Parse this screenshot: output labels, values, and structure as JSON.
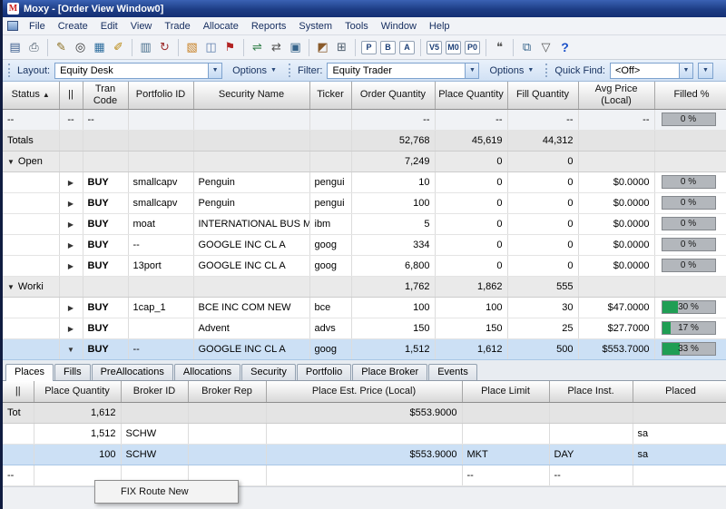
{
  "window": {
    "title": "Moxy - [Order View Window0]",
    "icon_letter": "M"
  },
  "icons": {
    "chevron_down": "▼",
    "sort_asc": "▲",
    "expand_right": "▶",
    "expand_down": "▼"
  },
  "menu": {
    "items": [
      "File",
      "Create",
      "Edit",
      "View",
      "Trade",
      "Allocate",
      "Reports",
      "System",
      "Tools",
      "Window",
      "Help"
    ]
  },
  "toolbar": {
    "icons": [
      {
        "name": "save-icon",
        "glyph": "▤",
        "color": "#3d5f8f"
      },
      {
        "name": "print-icon",
        "glyph": "⎙",
        "color": "#4a5a6a"
      },
      {
        "sep": true
      },
      {
        "name": "edit-icon",
        "glyph": "✎",
        "color": "#8a6d1d"
      },
      {
        "name": "find-icon",
        "glyph": "◎",
        "color": "#333333"
      },
      {
        "name": "worksheet-icon",
        "glyph": "▦",
        "color": "#2e6e9e"
      },
      {
        "name": "design-icon",
        "glyph": "✐",
        "color": "#b8860b"
      },
      {
        "sep": true
      },
      {
        "name": "blotter-icon",
        "glyph": "▥",
        "color": "#4a708e"
      },
      {
        "name": "refresh-icon",
        "glyph": "↻",
        "color": "#9e2f2f"
      },
      {
        "sep": true
      },
      {
        "name": "document-icon",
        "glyph": "▧",
        "color": "#c77e1e"
      },
      {
        "name": "notebook-icon",
        "glyph": "◫",
        "color": "#5f7fae"
      },
      {
        "name": "flag-icon",
        "glyph": "⚑",
        "color": "#b22222"
      },
      {
        "sep": true
      },
      {
        "name": "allocate-icon",
        "glyph": "⇌",
        "color": "#2e7d46"
      },
      {
        "name": "transfer-icon",
        "glyph": "⇄",
        "color": "#555555"
      },
      {
        "name": "monitor-icon",
        "glyph": "▣",
        "color": "#36648b"
      },
      {
        "sep": true
      },
      {
        "name": "chart-icon",
        "glyph": "◩",
        "color": "#8a5a2a"
      },
      {
        "name": "calculator-icon",
        "glyph": "⊞",
        "color": "#4f5f6f"
      },
      {
        "sep": true
      },
      {
        "name": "p-letter-icon",
        "glyph": "P",
        "boxed": true
      },
      {
        "name": "b-letter-icon",
        "glyph": "B",
        "boxed": true
      },
      {
        "name": "a-letter-icon",
        "glyph": "A",
        "boxed": true
      },
      {
        "sep": true
      },
      {
        "name": "v5-icon",
        "glyph": "V5",
        "boxed": true
      },
      {
        "name": "m0-icon",
        "glyph": "M0",
        "boxed": true
      },
      {
        "name": "p0-icon",
        "glyph": "P0",
        "boxed": true
      },
      {
        "sep": true
      },
      {
        "name": "comment-icon",
        "glyph": "❝",
        "color": "#555555"
      },
      {
        "sep": true
      },
      {
        "name": "report-window-icon",
        "glyph": "⧉",
        "color": "#36648b"
      },
      {
        "name": "filter-icon",
        "glyph": "▽",
        "color": "#555555"
      },
      {
        "name": "help-icon",
        "glyph": "?",
        "color": "#1a50c8",
        "bold": true
      }
    ]
  },
  "layout_bar": {
    "layout_label": "Layout:",
    "layout_value": "Equity Desk",
    "layout_options_label": "Options",
    "filter_label": "Filter:",
    "filter_value": "Equity Trader",
    "filter_options_label": "Options",
    "quick_find_label": "Quick Find:",
    "quick_find_value": "<Off>"
  },
  "orders_table": {
    "columns": [
      "Status",
      "||",
      "Tran Code",
      "Portfolio ID",
      "Security Name",
      "Ticker",
      "Order Quantity",
      "Place Quantity",
      "Fill Quantity",
      "Avg Price (Local)",
      "Filled %"
    ],
    "sort_column_index": 0,
    "rows": [
      {
        "type": "placeholder",
        "status": "--",
        "pause": "--",
        "tran": "--",
        "order": "--",
        "place": "--",
        "fill": "--",
        "price": "--",
        "filled_text": "0 %",
        "filled_pct": 0
      },
      {
        "type": "totals",
        "label": "Totals",
        "order": "52,768",
        "place": "45,619",
        "fill": "44,312"
      },
      {
        "type": "group",
        "label": "Open",
        "order": "7,249",
        "place": "0",
        "fill": "0"
      },
      {
        "type": "detail",
        "tran": "BUY",
        "portfolio": "smallcapv",
        "security": "Penguin",
        "ticker": "pengui",
        "order": "10",
        "place": "0",
        "fill": "0",
        "price": "$0.0000",
        "filled_text": "0 %",
        "filled_pct": 0
      },
      {
        "type": "detail",
        "tran": "BUY",
        "portfolio": "smallcapv",
        "security": "Penguin",
        "ticker": "pengui",
        "order": "100",
        "place": "0",
        "fill": "0",
        "price": "$0.0000",
        "filled_text": "0 %",
        "filled_pct": 0
      },
      {
        "type": "detail",
        "tran": "BUY",
        "portfolio": "moat",
        "security": "INTERNATIONAL BUS MA",
        "ticker": "ibm",
        "order": "5",
        "place": "0",
        "fill": "0",
        "price": "$0.0000",
        "filled_text": "0 %",
        "filled_pct": 0
      },
      {
        "type": "detail",
        "tran": "BUY",
        "portfolio": "--",
        "security": "GOOGLE INC CL A",
        "ticker": "goog",
        "order": "334",
        "place": "0",
        "fill": "0",
        "price": "$0.0000",
        "filled_text": "0 %",
        "filled_pct": 0
      },
      {
        "type": "detail",
        "tran": "BUY",
        "portfolio": "13port",
        "security": "GOOGLE INC CL A",
        "ticker": "goog",
        "order": "6,800",
        "place": "0",
        "fill": "0",
        "price": "$0.0000",
        "filled_text": "0 %",
        "filled_pct": 0
      },
      {
        "type": "group",
        "label": "Worki",
        "order": "1,762",
        "place": "1,862",
        "fill": "555"
      },
      {
        "type": "detail",
        "tran": "BUY",
        "portfolio": "1cap_1",
        "security": "BCE INC COM NEW",
        "ticker": "bce",
        "order": "100",
        "place": "100",
        "fill": "30",
        "price": "$47.0000",
        "filled_text": "30 %",
        "filled_pct": 30
      },
      {
        "type": "detail",
        "tran": "BUY",
        "portfolio": "",
        "security": "Advent",
        "ticker": "advs",
        "order": "150",
        "place": "150",
        "fill": "25",
        "price": "$27.7000",
        "filled_text": "17 %",
        "filled_pct": 17
      },
      {
        "type": "detail",
        "selected": true,
        "expanded": true,
        "tran": "BUY",
        "portfolio": "--",
        "security": "GOOGLE INC CL A",
        "ticker": "goog",
        "order": "1,512",
        "place": "1,612",
        "fill": "500",
        "price": "$553.7000",
        "filled_text": "33 %",
        "filled_pct": 33
      }
    ]
  },
  "tabs": {
    "items": [
      "Places",
      "Fills",
      "PreAllocations",
      "Allocations",
      "Security",
      "Portfolio",
      "Place Broker",
      "Events"
    ],
    "active": "Places"
  },
  "places_table": {
    "columns": [
      "||",
      "Place Quantity",
      "Broker ID",
      "Broker Rep",
      "Place Est. Price (Local)",
      "Place Limit",
      "Place Inst.",
      "Placed"
    ],
    "rows": [
      {
        "type": "totals",
        "pause": "Tot",
        "qty": "1,612",
        "price": "$553.9000"
      },
      {
        "type": "detail",
        "qty": "1,512",
        "broker": "SCHW",
        "placed": "sa"
      },
      {
        "type": "detail",
        "selected": true,
        "qty": "100",
        "broker": "SCHW",
        "price": "$553.9000",
        "limit": "MKT",
        "inst": "DAY",
        "placed": "sa"
      },
      {
        "type": "detail",
        "pause": "--",
        "limit": "--",
        "inst": "--"
      }
    ]
  },
  "context_menu": {
    "items": [
      "FIX Route New"
    ]
  }
}
